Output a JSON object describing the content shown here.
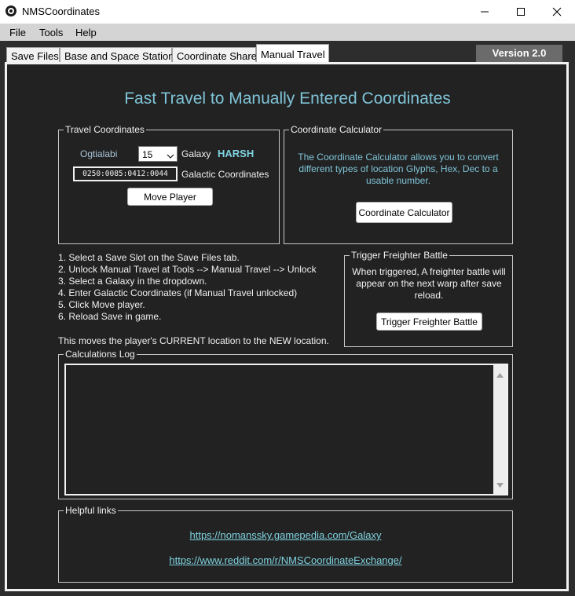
{
  "window": {
    "title": "NMSCoordinates"
  },
  "menu": [
    "File",
    "Tools",
    "Help"
  ],
  "tabs": [
    "Save Files",
    "Base and Space Station",
    "Coordinate Share",
    "Manual Travel"
  ],
  "version": "Version 2.0",
  "main": {
    "heading": "Fast Travel to Manually Entered Coordinates",
    "travel_coordinates": {
      "legend": "Travel Coordinates",
      "galaxy_name": "Ogtialabi",
      "galaxy_number": "15",
      "galaxy_label": "Galaxy",
      "galaxy_type": "HARSH",
      "coordinates_value": "0250:0085:0412:0044",
      "coordinates_label": "Galactic Coordinates",
      "move_button": "Move Player"
    },
    "coordinate_calculator": {
      "legend": "Coordinate Calculator",
      "description": "The Coordinate Calculator allows you to convert different types of location Glyphs, Hex, Dec to a usable number.",
      "button": "Coordinate Calculator"
    },
    "instructions": [
      "1. Select a Save Slot on the Save Files tab.",
      "2. Unlock Manual Travel at Tools --> Manual Travel --> Unlock",
      "3. Select a Galaxy in the dropdown.",
      "4. Enter Galactic Coordinates (if Manual Travel unlocked)",
      "5. Click Move player.",
      "6. Reload Save in game."
    ],
    "note": "This moves the player's CURRENT location to the NEW location.",
    "freighter": {
      "legend": "Trigger Freighter Battle",
      "description": "When triggered, A freighter battle will appear on the next warp after save reload.",
      "button": "Trigger Freighter Battle"
    },
    "log": {
      "legend": "Calculations Log"
    },
    "links": {
      "legend": "Helpful links",
      "items": [
        "https://nomanssky.gamepedia.com/Galaxy",
        "https://www.reddit.com/r/NMSCoordinateExchange/"
      ]
    }
  },
  "colors": {
    "heading": "#7fc4d8",
    "harsh": "#7fd3e0",
    "link": "#7fd3e0",
    "panel_bg": "#222222"
  },
  "icons": [
    "app-icon",
    "minimize-icon",
    "maximize-icon",
    "close-icon",
    "chevron-down-icon",
    "scroll-up-icon",
    "scroll-down-icon"
  ]
}
